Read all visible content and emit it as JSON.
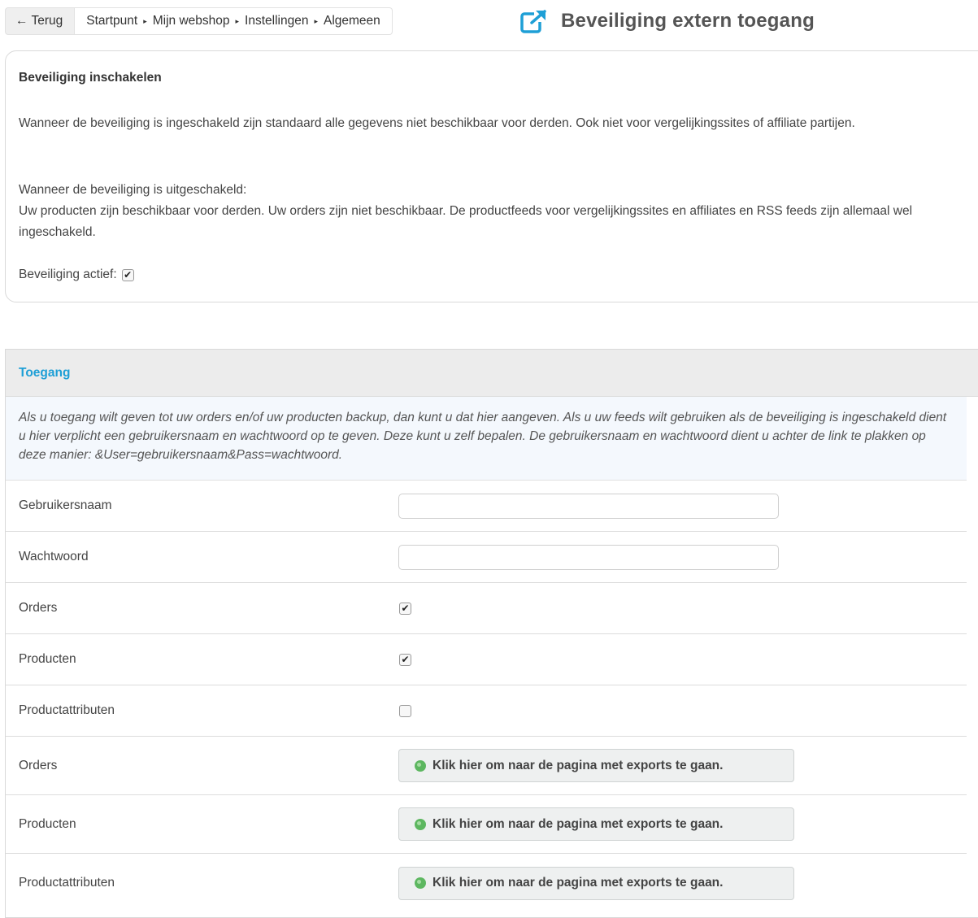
{
  "nav": {
    "back_label": "Terug",
    "back_arrow": "←",
    "breadcrumbs": [
      "Startpunt",
      "Mijn webshop",
      "Instellingen",
      "Algemeen"
    ],
    "separator": "▸"
  },
  "page": {
    "title": "Beveiliging extern toegang",
    "icon": "external-link-icon",
    "accent_color": "#1e9fd6"
  },
  "security": {
    "title": "Beveiliging inschakelen",
    "text_enabled": "Wanneer de beveiliging is ingeschakeld zijn standaard alle gegevens niet beschikbaar voor derden. Ook niet voor vergelijkingssites of affiliate partijen.",
    "text_disabled_heading": "Wanneer de beveiliging is uitgeschakeld:",
    "text_disabled": "Uw producten zijn beschikbaar voor derden. Uw orders zijn niet beschikbaar. De productfeeds voor vergelijkingssites en affiliates en RSS feeds zijn allemaal wel ingeschakeld.",
    "active_label": "Beveiliging actief:",
    "active_checked": true
  },
  "access": {
    "title": "Toegang",
    "info": "Als u toegang wilt geven tot uw orders en/of uw producten backup, dan kunt u dat hier aangeven. Als u uw feeds wilt gebruiken als de beveiliging is ingeschakeld dient u hier verplicht een gebruikersnaam en wachtwoord op te geven. Deze kunt u zelf bepalen. De gebruikersnaam en wachtwoord dient u achter de link te plakken op deze manier: &User=gebruikersnaam&Pass=wachtwoord.",
    "username_label": "Gebruikersnaam",
    "username_value": "",
    "password_label": "Wachtwoord",
    "password_value": "",
    "checkbox_rows": [
      {
        "label": "Orders",
        "checked": true
      },
      {
        "label": "Producten",
        "checked": true
      },
      {
        "label": "Productattributen",
        "checked": false
      }
    ],
    "export_rows": [
      {
        "label": "Orders",
        "button": "Klik hier om naar de pagina met exports te gaan."
      },
      {
        "label": "Producten",
        "button": "Klik hier om naar de pagina met exports te gaan."
      },
      {
        "label": "Productattributen",
        "button": "Klik hier om naar de pagina met exports te gaan."
      }
    ],
    "check_mark": "✔"
  }
}
